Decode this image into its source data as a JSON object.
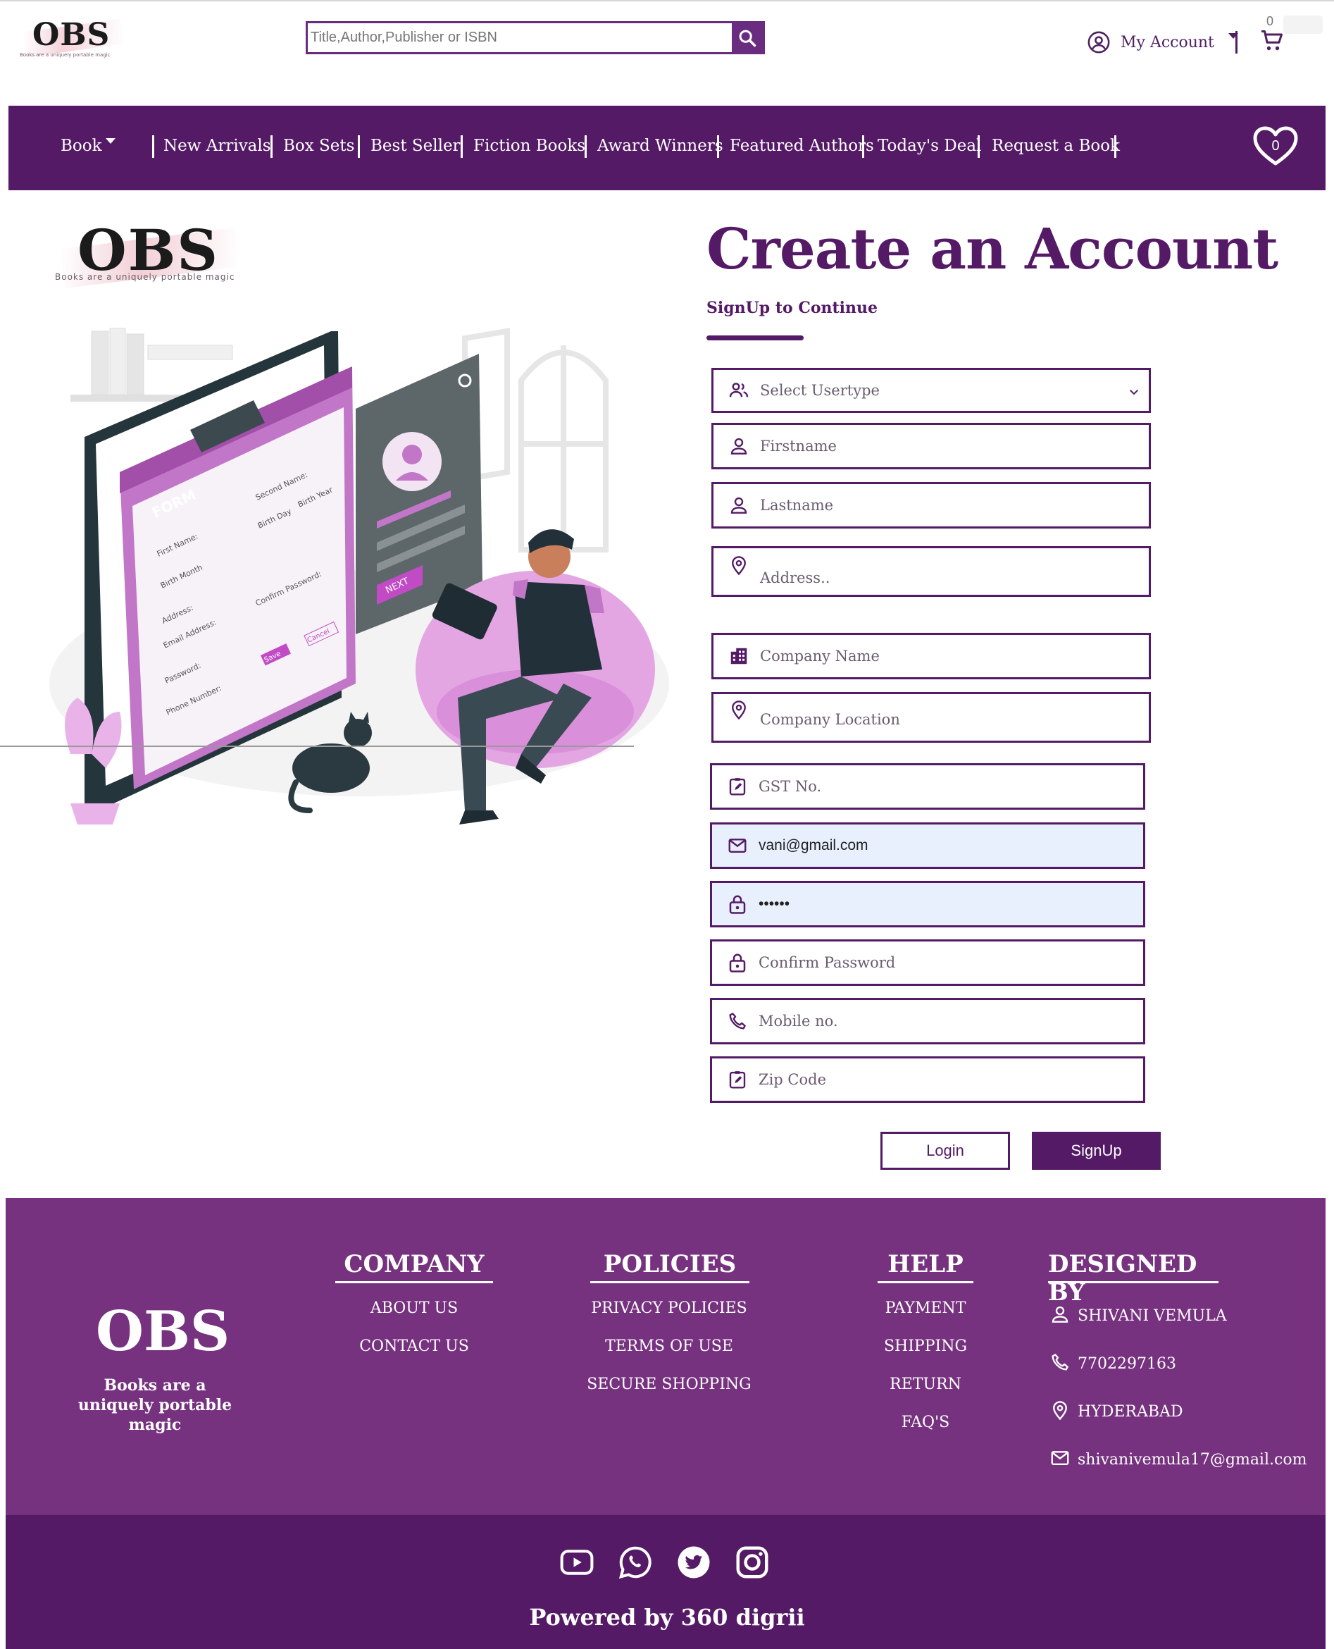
{
  "header": {
    "logo_text": "OBS",
    "logo_tagline": "Books are a uniquely portable magic",
    "search_placeholder": "Title,Author,Publisher or ISBN",
    "account_label": "My Account",
    "cart_count": "0"
  },
  "nav": {
    "items": [
      "Book",
      "New Arrivals",
      "Box Sets",
      "Best Seller",
      "Fiction Books",
      "Award Winners",
      "Featured Authors",
      "Today's Deal",
      "Request a Book"
    ],
    "wishlist_count": "0"
  },
  "brand_panel": {
    "logo_text": "OBS",
    "tagline": "Books are a uniquely portable magic",
    "illustration_labels": {
      "form_title": "FORM",
      "first_name": "First Name:",
      "second_name": "Second Name:",
      "birth_month": "Birth Month",
      "birth_day": "Birth Day",
      "birth_year": "Birth Year",
      "address": "Address:",
      "email": "Email Address:",
      "confirm_password": "Confirm Password:",
      "password": "Password:",
      "phone": "Phone Number:",
      "save": "Save",
      "cancel": "Cancel",
      "next": "NEXT"
    }
  },
  "form": {
    "title": "Create an Account",
    "subtitle": "SignUp to Continue",
    "usertype_placeholder": "Select Usertype",
    "firstname": "Firstname",
    "lastname": "Lastname",
    "address": "Address..",
    "company_name": "Company Name",
    "company_location": "Company Location",
    "gst": "GST No.",
    "email_value": "vani@gmail.com",
    "password_value": "••••••",
    "confirm_password": "Confirm Password",
    "mobile": "Mobile no.",
    "zip": "Zip Code",
    "login_label": "Login",
    "signup_label": "SignUp"
  },
  "footer": {
    "logo_text": "OBS",
    "tagline": "Books are a uniquely portable magic",
    "company": {
      "title": "COMPANY",
      "links": [
        "ABOUT US",
        "CONTACT US"
      ]
    },
    "policies": {
      "title": "POLICIES",
      "links": [
        "PRIVACY POLICIES",
        "TERMS OF USE",
        "SECURE SHOPPING"
      ]
    },
    "help": {
      "title": "HELP",
      "links": [
        "PAYMENT",
        "SHIPPING",
        "RETURN",
        "FAQ'S"
      ]
    },
    "designed_by": {
      "title": "DESIGNED BY",
      "name": "SHIVANI VEMULA",
      "phone": "7702297163",
      "city": "HYDERABAD",
      "email": "shivanivemula17@gmail.com"
    },
    "social_icons": [
      "youtube-icon",
      "whatsapp-icon",
      "twitter-icon",
      "instagram-icon"
    ],
    "powered_by": "Powered by 360 digrii"
  },
  "colors": {
    "primary": "#541a66",
    "footer": "#76317f",
    "filled_field": "#e8effd",
    "illustration_pink": "#d98fd9"
  }
}
